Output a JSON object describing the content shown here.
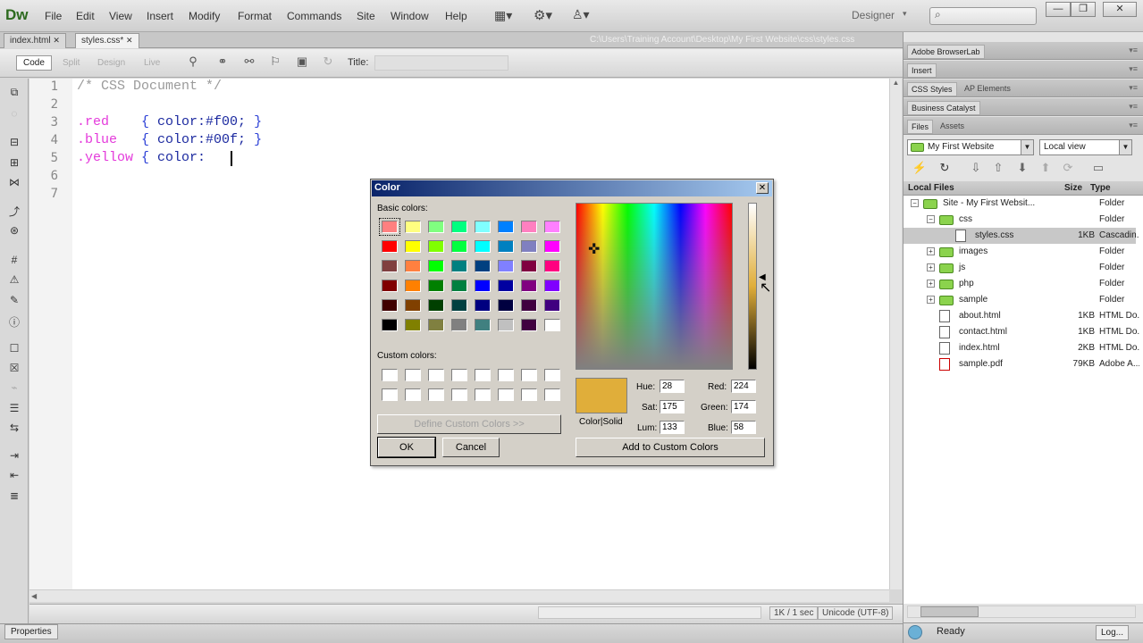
{
  "app": {
    "logo": "Dw",
    "workspace": "Designer",
    "workspace_arrow": "▾"
  },
  "menu": [
    "File",
    "Edit",
    "View",
    "Insert",
    "Modify",
    "Format",
    "Commands",
    "Site",
    "Window",
    "Help"
  ],
  "window_buttons": [
    "—",
    "❐",
    "✕"
  ],
  "doc_tabs": [
    {
      "label": "index.html",
      "close": "✕"
    },
    {
      "label": "styles.css*",
      "close": "✕"
    }
  ],
  "doc_path": "C:\\Users\\Training Account\\Desktop\\My First Website\\css\\styles.css",
  "view_buttons": [
    "Code",
    "Split",
    "Design",
    "Live"
  ],
  "title_label": "Title:",
  "code_lines": [
    {
      "num": "1",
      "parts": [
        {
          "t": "/* CSS Document */",
          "c": "c-com"
        }
      ]
    },
    {
      "num": "2",
      "parts": []
    },
    {
      "num": "3",
      "parts": [
        {
          "t": ".red    ",
          "c": "c-sel"
        },
        {
          "t": "{ ",
          "c": "c-brace"
        },
        {
          "t": "color:",
          "c": "c-prop"
        },
        {
          "t": "#f00; ",
          "c": "c-val"
        },
        {
          "t": "}",
          "c": "c-brace"
        }
      ]
    },
    {
      "num": "4",
      "parts": [
        {
          "t": ".blue   ",
          "c": "c-sel"
        },
        {
          "t": "{ ",
          "c": "c-brace"
        },
        {
          "t": "color:",
          "c": "c-prop"
        },
        {
          "t": "#00f; ",
          "c": "c-val"
        },
        {
          "t": "}",
          "c": "c-brace"
        }
      ]
    },
    {
      "num": "5",
      "parts": [
        {
          "t": ".yellow ",
          "c": "c-sel"
        },
        {
          "t": "{ ",
          "c": "c-brace"
        },
        {
          "t": "color:",
          "c": "c-prop"
        }
      ]
    },
    {
      "num": "6",
      "parts": []
    },
    {
      "num": "7",
      "parts": []
    }
  ],
  "status": {
    "size": "1K / 1 sec",
    "encoding": "Unicode (UTF-8)"
  },
  "properties_tab": "Properties",
  "panels": {
    "browserlab": "Adobe BrowserLab",
    "insert": "Insert",
    "css_tabs": [
      "CSS Styles",
      "AP Elements"
    ],
    "catalyst": "Business Catalyst",
    "files_tabs": [
      "Files",
      "Assets"
    ],
    "site_select": "My First Website",
    "view_select": "Local view",
    "headers": {
      "name": "Local Files",
      "size": "Size",
      "type": "Type"
    },
    "files": [
      {
        "name": "Site - My First Websit...",
        "size": "",
        "type": "Folder",
        "kind": "folder",
        "toggle": "−",
        "indent": 0
      },
      {
        "name": "css",
        "size": "",
        "type": "Folder",
        "kind": "folder",
        "toggle": "−",
        "indent": 1
      },
      {
        "name": "styles.css",
        "size": "1KB",
        "type": "Cascadin...",
        "kind": "doc",
        "toggle": "",
        "indent": 2,
        "selected": true
      },
      {
        "name": "images",
        "size": "",
        "type": "Folder",
        "kind": "folder",
        "toggle": "+",
        "indent": 1
      },
      {
        "name": "js",
        "size": "",
        "type": "Folder",
        "kind": "folder",
        "toggle": "+",
        "indent": 1
      },
      {
        "name": "php",
        "size": "",
        "type": "Folder",
        "kind": "folder",
        "toggle": "+",
        "indent": 1
      },
      {
        "name": "sample",
        "size": "",
        "type": "Folder",
        "kind": "folder",
        "toggle": "+",
        "indent": 1
      },
      {
        "name": "about.html",
        "size": "1KB",
        "type": "HTML Do...",
        "kind": "doc",
        "toggle": "",
        "indent": 1
      },
      {
        "name": "contact.html",
        "size": "1KB",
        "type": "HTML Do...",
        "kind": "doc",
        "toggle": "",
        "indent": 1
      },
      {
        "name": "index.html",
        "size": "2KB",
        "type": "HTML Do...",
        "kind": "doc",
        "toggle": "",
        "indent": 1
      },
      {
        "name": "sample.pdf",
        "size": "79KB",
        "type": "Adobe A...",
        "kind": "pdf",
        "toggle": "",
        "indent": 1
      }
    ],
    "ready": "Ready",
    "log": "Log..."
  },
  "color_dialog": {
    "title": "Color",
    "close": "✕",
    "basic_label": "Basic colors:",
    "custom_label": "Custom colors:",
    "basic_colors": [
      "#ff8080",
      "#ffff80",
      "#80ff80",
      "#00ff80",
      "#80ffff",
      "#0080ff",
      "#ff80c0",
      "#ff80ff",
      "#ff0000",
      "#ffff00",
      "#80ff00",
      "#00ff40",
      "#00ffff",
      "#0080c0",
      "#8080c0",
      "#ff00ff",
      "#804040",
      "#ff8040",
      "#00ff00",
      "#008080",
      "#004080",
      "#8080ff",
      "#800040",
      "#ff0080",
      "#800000",
      "#ff8000",
      "#008000",
      "#008040",
      "#0000ff",
      "#0000a0",
      "#800080",
      "#8000ff",
      "#400000",
      "#804000",
      "#004000",
      "#004040",
      "#000080",
      "#000040",
      "#400040",
      "#400080",
      "#000000",
      "#808000",
      "#808040",
      "#808080",
      "#408080",
      "#c0c0c0",
      "#400040",
      "#ffffff"
    ],
    "define_button": "Define Custom Colors >>",
    "ok": "OK",
    "cancel": "Cancel",
    "colorsolid_label": "Color|Solid",
    "hue_label": "Hue:",
    "hue": "28",
    "sat_label": "Sat:",
    "sat": "175",
    "lum_label": "Lum:",
    "lum": "133",
    "red_label": "Red:",
    "red": "224",
    "green_label": "Green:",
    "green": "174",
    "blue_label": "Blue:",
    "blue": "58",
    "add_button": "Add to Custom Colors",
    "current_color": "#e0ae3a"
  }
}
